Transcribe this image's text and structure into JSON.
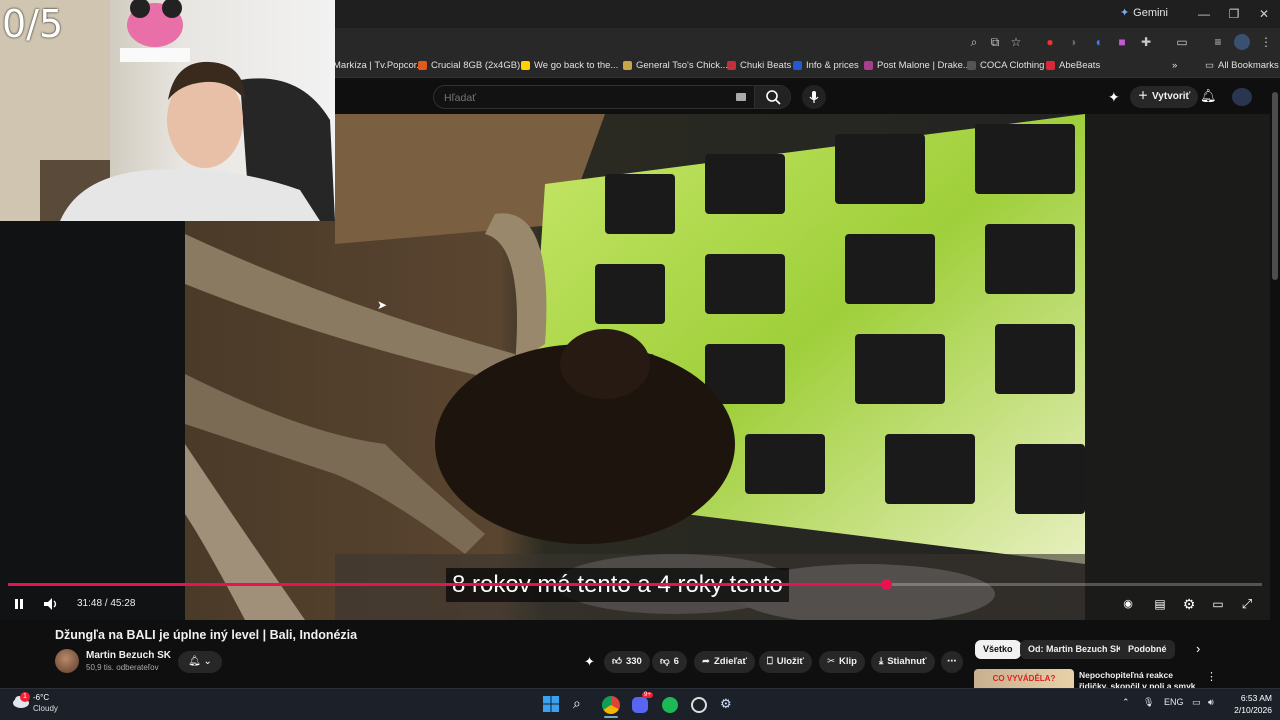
{
  "browser": {
    "gemini_label": "Gemini",
    "window_controls": [
      "—",
      "❐",
      "✕"
    ],
    "all_bookmarks": "All Bookmarks",
    "bookmarks": [
      {
        "label": "Markíza | Tv.Popcor...",
        "color": "#888888"
      },
      {
        "label": "Crucial 8GB (2x4GB)...",
        "color": "#e05a1e"
      },
      {
        "label": "We go back to the...",
        "color": "#ffd200"
      },
      {
        "label": "General Tso's Chick...",
        "color": "#c7a64a"
      },
      {
        "label": "Chuki Beats",
        "color": "#c2313b"
      },
      {
        "label": "Info & prices",
        "color": "#2357d8"
      },
      {
        "label": "Post Malone | Drake...",
        "color": "#a73f8e"
      },
      {
        "label": "COCA Clothing",
        "color": "#333333"
      },
      {
        "label": "AbeBeats",
        "color": "#d8283a"
      }
    ]
  },
  "youtube": {
    "search_placeholder": "Hľadať",
    "create_label": "Vytvoriť",
    "player": {
      "counter_overlay": "0/5",
      "subtitle": "8 rokov má tento a 4 roky tento",
      "time_current": "31:48",
      "time_total": "45:28",
      "time_sep": " / ",
      "progress_fraction": 0.7
    },
    "video": {
      "title": "Džungľa na BALI je úplne iný level | Bali, Indonézia",
      "channel": "Martin Bezuch SK",
      "subscribers": "50,9 tis. odberateľov"
    },
    "actions": {
      "likes": "330",
      "dislikes": "6",
      "share": "Zdieľať",
      "save": "Uložiť",
      "clip": "Klip",
      "download": "Stiahnuť"
    },
    "chips": [
      "Všetko",
      "Od: Martin Bezuch SK",
      "Podobné"
    ],
    "recommendation": {
      "thumb_text": "CO VYVÁDĚLA?",
      "title": "Nepochopiteľná reakce řidičky, skončil v poli a smyk na ledovce"
    }
  },
  "taskbar": {
    "temperature": "-6°C",
    "weather": "Cloudy",
    "notification_count": "1",
    "discord_badge": "9+",
    "language": "ENG",
    "time": "6:53 AM",
    "date": "2/10/2026"
  }
}
